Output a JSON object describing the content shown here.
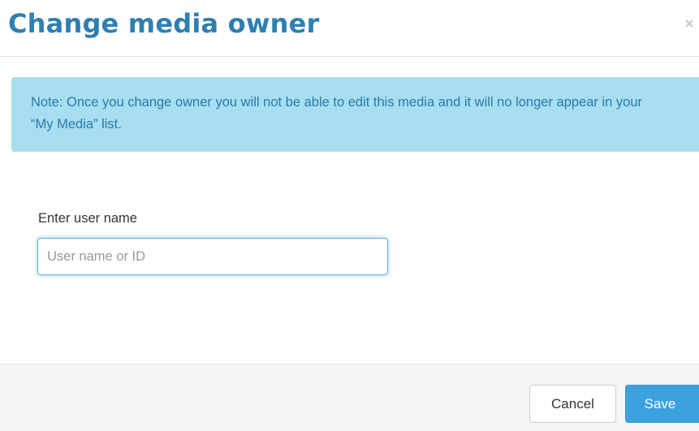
{
  "dialog": {
    "title": "Change media owner",
    "close_icon": "close-icon"
  },
  "note": {
    "text": "Note: Once you change owner you will not be able to edit this media and it will no longer appear in your “My Media” list."
  },
  "form": {
    "label": "Enter user name",
    "input_value": "",
    "input_placeholder": "User name or ID"
  },
  "footer": {
    "cancel_label": "Cancel",
    "save_label": "Save"
  },
  "colors": {
    "title": "#2f7fb1",
    "alert_bg": "#a7dff1",
    "alert_text": "#2a78a8",
    "save_bg": "#3ea1df",
    "input_focus_border": "#66afe9",
    "footer_bg": "#f5f5f5"
  }
}
